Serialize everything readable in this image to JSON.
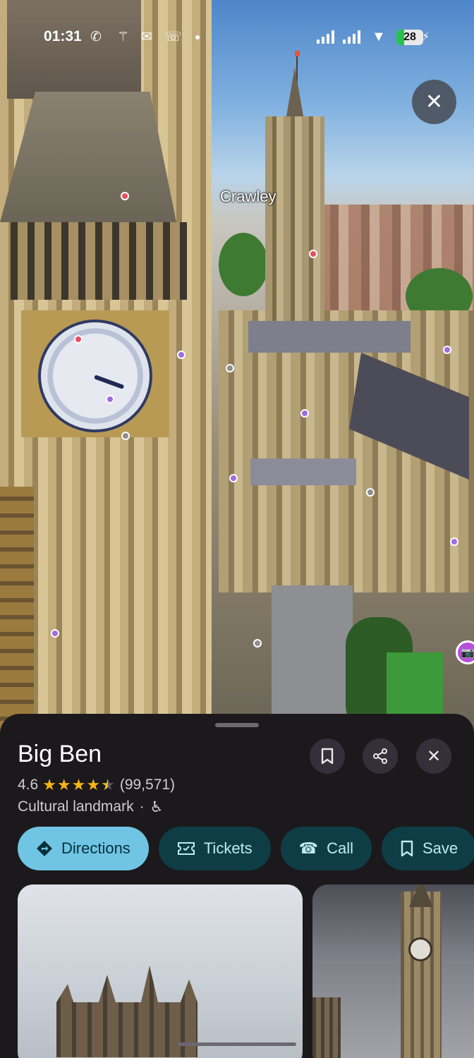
{
  "status_bar": {
    "time": "01:31",
    "notification_icons": [
      "whatsapp-icon",
      "puzzle-icon",
      "chat-icon",
      "phone-forward-icon"
    ],
    "battery_level": "28",
    "battery_fill": 0.28,
    "charging": true
  },
  "map": {
    "place_label": "Crawley"
  },
  "place": {
    "name": "Big Ben",
    "rating": "4.6",
    "stars": 4.6,
    "review_count": "(99,571)",
    "category": "Cultural landmark",
    "separator": "·",
    "accessibility_icon": "wheelchair-icon"
  },
  "header_buttons": {
    "save": "bookmark-icon",
    "share": "share-icon",
    "close": "close-icon"
  },
  "actions": [
    {
      "label": "Directions",
      "icon": "directions-icon",
      "primary": true
    },
    {
      "label": "Tickets",
      "icon": "ticket-icon",
      "primary": false
    },
    {
      "label": "Call",
      "icon": "phone-icon",
      "primary": false
    },
    {
      "label": "Save",
      "icon": "bookmark-icon",
      "primary": false
    }
  ],
  "colors": {
    "sheet_bg": "#1b191c",
    "primary_chip": "#6fc5e3",
    "secondary_chip": "#0f3d46",
    "star": "#f6b515"
  }
}
